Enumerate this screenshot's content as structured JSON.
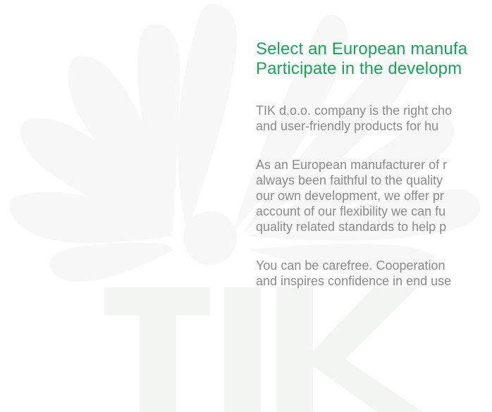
{
  "colors": {
    "accent": "#17a556",
    "body_text": "#8a8a8a",
    "watermark": "#f6f7f6"
  },
  "watermark": {
    "brand_text": "TIK",
    "icon": "flower-logo-watermark"
  },
  "heading": {
    "line1": "Select an European manufa",
    "line2": "Participate in the developm"
  },
  "paragraphs": [
    {
      "lines": [
        "TIK d.o.o. company is the right cho",
        "and user-friendly products for hu"
      ]
    },
    {
      "lines": [
        "As an European manufacturer of r",
        "always been faithful to the quality",
        "our own development, we offer pr",
        "account of our flexibility we can fu",
        "quality related standards to help p"
      ]
    },
    {
      "lines": [
        "You can be carefree. Cooperation",
        "and inspires confidence in end use"
      ]
    }
  ]
}
